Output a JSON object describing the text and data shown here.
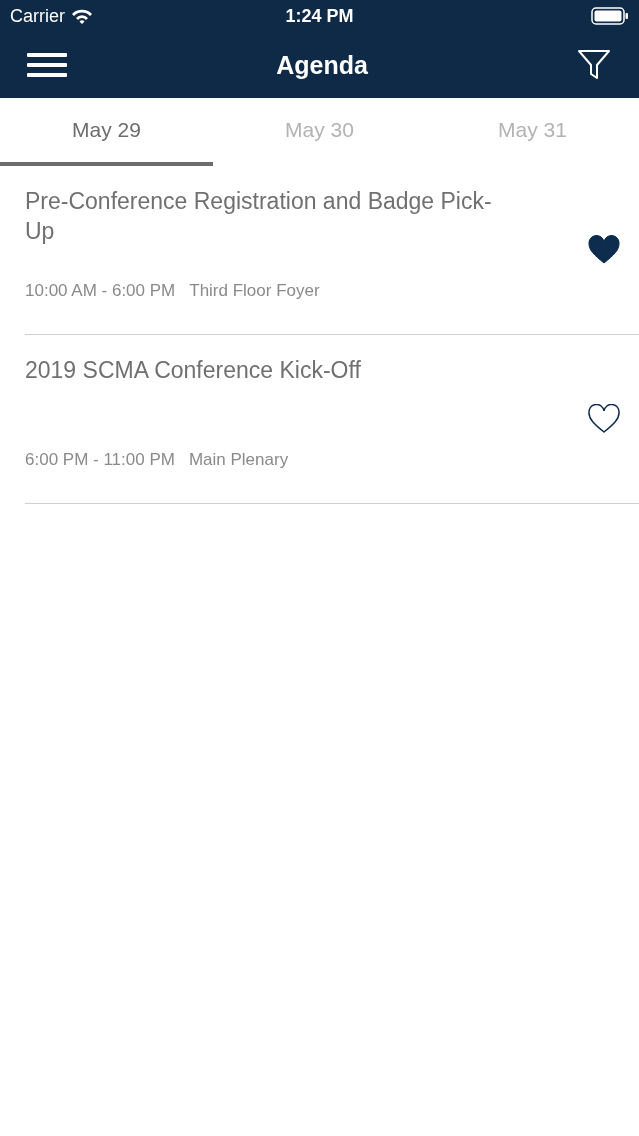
{
  "status_bar": {
    "carrier": "Carrier",
    "time": "1:24 PM"
  },
  "header": {
    "title": "Agenda"
  },
  "tabs": [
    {
      "label": "May 29",
      "selected": true
    },
    {
      "label": "May 30",
      "selected": false
    },
    {
      "label": "May 31",
      "selected": false
    }
  ],
  "sessions": [
    {
      "title": "Pre-Conference Registration and Badge Pick-Up",
      "time": "10:00 AM - 6:00 PM",
      "location": "Third Floor Foyer",
      "favorite": true
    },
    {
      "title": "2019 SCMA Conference Kick-Off",
      "time": "6:00 PM - 11:00 PM",
      "location": "Main Plenary",
      "favorite": false
    }
  ]
}
